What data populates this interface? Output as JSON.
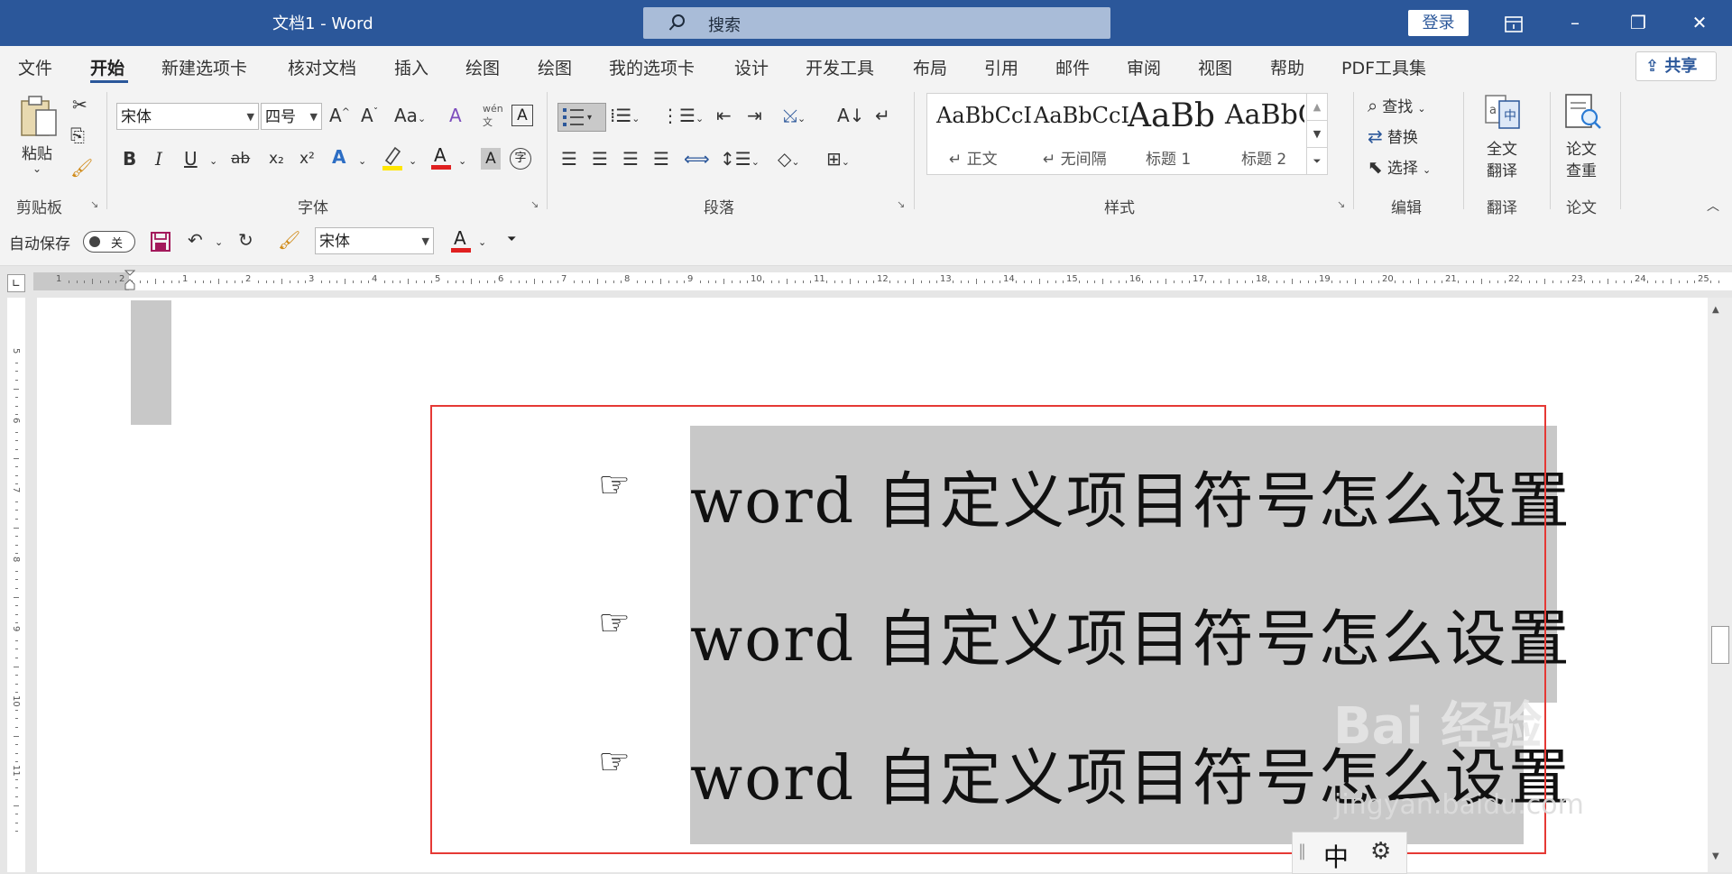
{
  "title_bar": {
    "doc_title": "文档1  -  Word",
    "search_placeholder": "搜索",
    "login": "登录",
    "win_ribbon_icon": "ribbon-display-icon",
    "minimize": "–",
    "restore": "❐",
    "close": "✕"
  },
  "tabs": [
    "文件",
    "开始",
    "新建选项卡",
    "核对文档",
    "插入",
    "绘图",
    "绘图",
    "我的选项卡",
    "设计",
    "开发工具",
    "布局",
    "引用",
    "邮件",
    "审阅",
    "视图",
    "帮助",
    "PDF工具集"
  ],
  "active_tab": "开始",
  "share": "共享",
  "ribbon": {
    "clipboard": {
      "paste": "粘贴",
      "label": "剪贴板"
    },
    "font": {
      "name": "宋体",
      "size": "四号",
      "label": "字体",
      "grow": "A^",
      "shrink": "Aˇ",
      "case": "Aa",
      "bold": "B",
      "italic": "I",
      "underline": "U",
      "strike": "ab",
      "sub": "x₂",
      "sup": "x²",
      "phonetic_top": "wén",
      "phonetic_bottom": "文"
    },
    "paragraph": {
      "label": "段落"
    },
    "styles": {
      "label": "样式",
      "items": [
        {
          "preview": "AaBbCcI",
          "name": "↵ 正文"
        },
        {
          "preview": "AaBbCcI",
          "name": "↵ 无间隔"
        },
        {
          "preview": "AaBb",
          "name": "标题 1"
        },
        {
          "preview": "AaBbC",
          "name": "标题 2"
        }
      ]
    },
    "editing": {
      "find": "查找",
      "replace": "替换",
      "select": "选择",
      "label": "编辑"
    },
    "translate": {
      "btn_top": "全文",
      "btn_bottom": "翻译",
      "label": "翻译"
    },
    "paper": {
      "btn_top": "论文",
      "btn_bottom": "查重",
      "label": "论文"
    }
  },
  "qat": {
    "autosave": "自动保存",
    "toggle": "关",
    "font": "宋体"
  },
  "ruler_numbers": [
    "1",
    "2",
    "1",
    "2",
    "3",
    "4",
    "5",
    "6",
    "7",
    "8",
    "9",
    "10",
    "11",
    "12",
    "13",
    "14",
    "15",
    "16",
    "17",
    "18",
    "19",
    "20",
    "21",
    "22",
    "23",
    "24",
    "25"
  ],
  "vruler_numbers": [
    "5",
    "6",
    "7",
    "8",
    "9",
    "10",
    "11"
  ],
  "document": {
    "bullet_symbol": "☞",
    "lines": [
      "word 自定义项目符号怎么设置",
      "word 自定义项目符号怎么设置",
      "word 自定义项目符号怎么设置"
    ]
  },
  "ime": {
    "mode": "中"
  },
  "watermark": {
    "brand": "Bai 经验",
    "url": "jingyan.baidu.com"
  },
  "colors": {
    "title_bar": "#2b579a",
    "highlight": "#c8c8c8",
    "annotation_box": "#e53935",
    "font_color": "#e02020",
    "highlighter": "#ffe600"
  }
}
